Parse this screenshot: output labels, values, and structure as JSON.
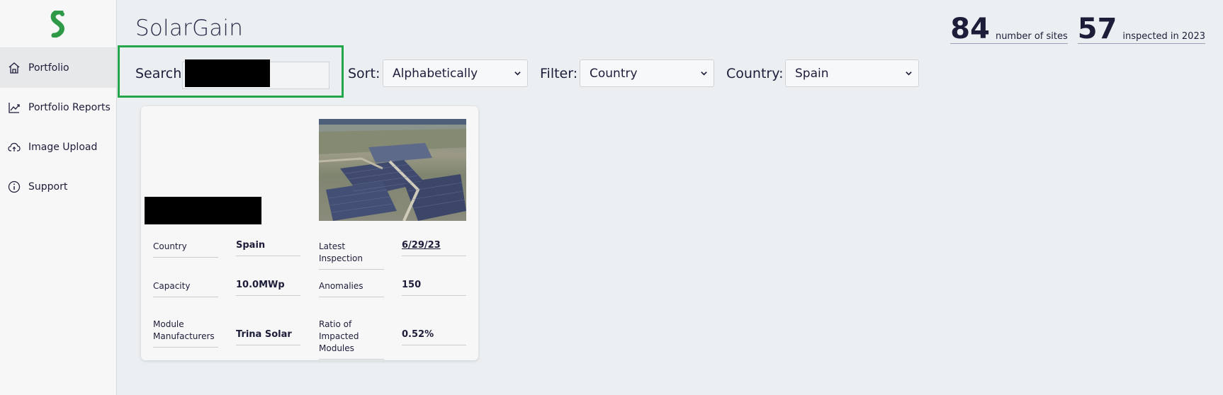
{
  "app": {
    "title": "SolarGain"
  },
  "stats": [
    {
      "value": "84",
      "label": "number of sites"
    },
    {
      "value": "57",
      "label": "inspected in 2023"
    }
  ],
  "sidebar": {
    "items": [
      {
        "label": "Portfolio",
        "icon": "home-icon",
        "active": true
      },
      {
        "label": "Portfolio Reports",
        "icon": "chart-line-icon",
        "active": false
      },
      {
        "label": "Image Upload",
        "icon": "cloud-upload-icon",
        "active": false
      },
      {
        "label": "Support",
        "icon": "info-icon",
        "active": false
      }
    ]
  },
  "toolbar": {
    "search_label": "Search:",
    "search_value": "",
    "sort_label": "Sort:",
    "sort_value": "Alphabetically",
    "filter_label": "Filter:",
    "filter_value": "Country",
    "country_label": "Country:",
    "country_value": "Spain"
  },
  "site_card": {
    "fields": [
      {
        "label": "Country",
        "value": "Spain"
      },
      {
        "label": "Capacity",
        "value": "10.0MWp"
      },
      {
        "label": "Module Manufacturers",
        "value": "Trina Solar"
      },
      {
        "label": "Latest Inspection",
        "value": "6/29/23"
      },
      {
        "label": "Anomalies",
        "value": "150"
      },
      {
        "label": "Ratio of Impacted Modules",
        "value": "0.52%"
      }
    ]
  },
  "colors": {
    "accent": "#22a649",
    "text": "#1d1d3a",
    "logo": "#2e9a48"
  }
}
